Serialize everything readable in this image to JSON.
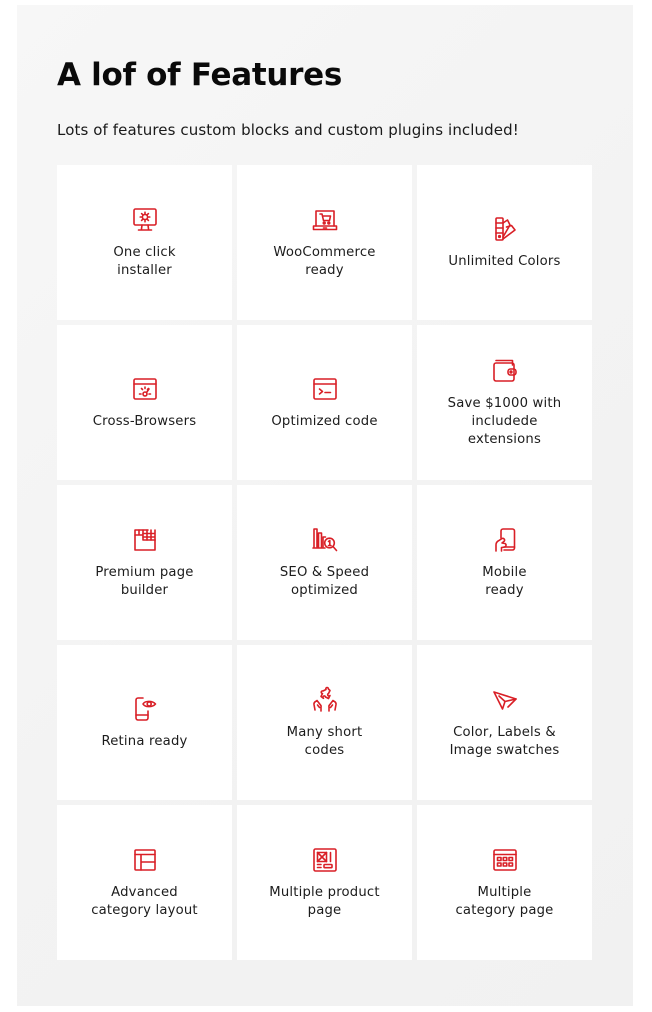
{
  "header": {
    "title": "A lof of Features",
    "subtitle": "Lots of features custom blocks and custom plugins included!"
  },
  "theme": {
    "accent": "#d91f26",
    "card_bg": "#ffffff",
    "panel_bg": "#f2f2f2",
    "text": "#1c1c1c"
  },
  "features": [
    {
      "label": "One click\ninstaller",
      "icon": "monitor-gear-icon"
    },
    {
      "label": "WooCommerce\nready",
      "icon": "laptop-cart-icon"
    },
    {
      "label": "Unlimited Colors",
      "icon": "color-swatch-icon"
    },
    {
      "label": "Cross-Browsers",
      "icon": "browser-speed-icon"
    },
    {
      "label": "Optimized code",
      "icon": "terminal-window-icon"
    },
    {
      "label": "Save $1000 with\nincludede\nextensions",
      "icon": "wallet-icon"
    },
    {
      "label": "Premium page\nbuilder",
      "icon": "page-grid-icon"
    },
    {
      "label": "SEO & Speed\noptimized",
      "icon": "chart-magnifier-icon"
    },
    {
      "label": "Mobile\nready",
      "icon": "hand-phone-icon"
    },
    {
      "label": "Retina ready",
      "icon": "phone-eye-icon"
    },
    {
      "label": "Many short\ncodes",
      "icon": "hands-puzzle-icon"
    },
    {
      "label": "Color, Labels &\nImage swatches",
      "icon": "paper-plane-icon"
    },
    {
      "label": "Advanced\ncategory layout",
      "icon": "layout-icon"
    },
    {
      "label": "Multiple product\npage",
      "icon": "product-page-icon"
    },
    {
      "label": "Multiple\ncategory page",
      "icon": "calendar-grid-icon"
    }
  ]
}
